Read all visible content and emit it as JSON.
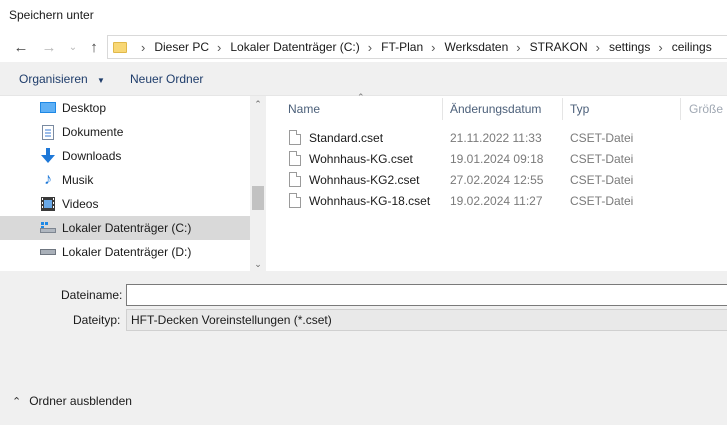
{
  "window": {
    "title": "Speichern unter"
  },
  "nav": {
    "back_icon": "arrow-left-icon",
    "forward_icon": "arrow-right-icon",
    "recent_icon": "chevron-down-icon",
    "up_icon": "arrow-up-icon"
  },
  "breadcrumb": {
    "items": [
      "Dieser PC",
      "Lokaler Datenträger (C:)",
      "FT-Plan",
      "Werksdaten",
      "STRAKON",
      "settings",
      "ceilings"
    ]
  },
  "toolbar": {
    "organize_label": "Organisieren",
    "new_folder_label": "Neuer Ordner"
  },
  "sidebar": {
    "items": [
      {
        "label": "Desktop",
        "icon": "desktop-icon"
      },
      {
        "label": "Dokumente",
        "icon": "documents-icon"
      },
      {
        "label": "Downloads",
        "icon": "download-icon"
      },
      {
        "label": "Musik",
        "icon": "music-icon"
      },
      {
        "label": "Videos",
        "icon": "video-icon"
      },
      {
        "label": "Lokaler Datenträger (C:)",
        "icon": "drive-icon",
        "selected": true
      },
      {
        "label": "Lokaler Datenträger (D:)",
        "icon": "drive-icon"
      }
    ]
  },
  "columns": {
    "name": "Name",
    "date": "Änderungsdatum",
    "type": "Typ",
    "size": "Größe"
  },
  "files": [
    {
      "name": "Standard.cset",
      "date": "21.11.2022 11:33",
      "type": "CSET-Datei"
    },
    {
      "name": "Wohnhaus-KG.cset",
      "date": "19.01.2024 09:18",
      "type": "CSET-Datei"
    },
    {
      "name": "Wohnhaus-KG2.cset",
      "date": "27.02.2024 12:55",
      "type": "CSET-Datei"
    },
    {
      "name": "Wohnhaus-KG-18.cset",
      "date": "19.02.2024 11:27",
      "type": "CSET-Datei"
    }
  ],
  "form": {
    "filename_label": "Dateiname:",
    "filename_value": "",
    "filetype_label": "Dateityp:",
    "filetype_value": "HFT-Decken Voreinstellungen (*.cset)"
  },
  "footer": {
    "hide_folders_label": "Ordner ausblenden"
  },
  "colors": {
    "selection": "#d9d9d9",
    "link": "#1f3d6b",
    "folder": "#f8d775"
  }
}
